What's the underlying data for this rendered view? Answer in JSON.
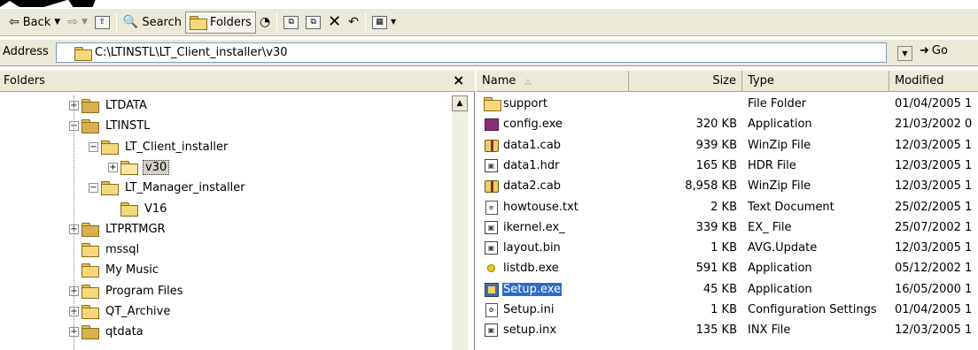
{
  "toolbar": {
    "back_label": "Back",
    "search_label": "Search",
    "folders_label": "Folders"
  },
  "address": {
    "label": "Address",
    "value": "C:\\LTINSTL\\LT_Client_installer\\v30",
    "go_label": "Go"
  },
  "folders_pane": {
    "title": "Folders",
    "close_glyph": "×",
    "tree": [
      {
        "label": "LTDATA",
        "level": 0,
        "expander": "+",
        "icon": "network-folder-icon"
      },
      {
        "label": "LTINSTL",
        "level": 0,
        "expander": "-",
        "icon": "network-folder-icon"
      },
      {
        "label": "LT_Client_installer",
        "level": 1,
        "expander": "-",
        "icon": "folder-icon"
      },
      {
        "label": "v30",
        "level": 2,
        "expander": "+",
        "icon": "open-folder-icon",
        "selected": true
      },
      {
        "label": "LT_Manager_installer",
        "level": 1,
        "expander": "-",
        "icon": "folder-icon"
      },
      {
        "label": "V16",
        "level": 2,
        "expander": "",
        "icon": "folder-icon"
      },
      {
        "label": "LTPRTMGR",
        "level": 0,
        "expander": "+",
        "icon": "network-folder-icon"
      },
      {
        "label": "mssql",
        "level": 0,
        "expander": "",
        "icon": "folder-icon"
      },
      {
        "label": "My Music",
        "level": 0,
        "expander": "",
        "icon": "folder-icon"
      },
      {
        "label": "Program Files",
        "level": 0,
        "expander": "+",
        "icon": "folder-icon"
      },
      {
        "label": "QT_Archive",
        "level": 0,
        "expander": "+",
        "icon": "folder-icon"
      },
      {
        "label": "qtdata",
        "level": 0,
        "expander": "+",
        "icon": "network-folder-icon"
      }
    ]
  },
  "file_list": {
    "columns": [
      "Name",
      "Size",
      "Type",
      "Modified"
    ],
    "rows": [
      {
        "name": "support",
        "size": "",
        "type": "File Folder",
        "modified": "01/04/2005 1",
        "icon": "folder-icon"
      },
      {
        "name": "config.exe",
        "size": "320 KB",
        "type": "Application",
        "modified": "21/03/2002 0",
        "icon": "exe-icon"
      },
      {
        "name": "data1.cab",
        "size": "939 KB",
        "type": "WinZip File",
        "modified": "12/03/2005 1",
        "icon": "zip-icon"
      },
      {
        "name": "data1.hdr",
        "size": "165 KB",
        "type": "HDR File",
        "modified": "12/03/2005 1",
        "icon": "window-file-icon"
      },
      {
        "name": "data2.cab",
        "size": "8,958 KB",
        "type": "WinZip File",
        "modified": "12/03/2005 1",
        "icon": "zip-icon"
      },
      {
        "name": "howtouse.txt",
        "size": "2 KB",
        "type": "Text Document",
        "modified": "25/02/2005 1",
        "icon": "text-file-icon"
      },
      {
        "name": "ikernel.ex_",
        "size": "339 KB",
        "type": "EX_ File",
        "modified": "25/07/2002 1",
        "icon": "window-file-icon"
      },
      {
        "name": "layout.bin",
        "size": "1 KB",
        "type": "AVG.Update",
        "modified": "12/03/2005 1",
        "icon": "window-file-icon"
      },
      {
        "name": "listdb.exe",
        "size": "591 KB",
        "type": "Application",
        "modified": "05/12/2002 1",
        "icon": "ball-icon"
      },
      {
        "name": "Setup.exe",
        "size": "45 KB",
        "type": "Application",
        "modified": "16/05/2000 1",
        "icon": "setup-icon",
        "selected": true
      },
      {
        "name": "Setup.ini",
        "size": "1 KB",
        "type": "Configuration Settings",
        "modified": "01/04/2005 1",
        "icon": "ini-file-icon"
      },
      {
        "name": "setup.inx",
        "size": "135 KB",
        "type": "INX File",
        "modified": "12/03/2005 1",
        "icon": "window-file-icon"
      }
    ]
  },
  "colors": {
    "chrome": "#ece9d8",
    "selection": "#316ac5"
  }
}
